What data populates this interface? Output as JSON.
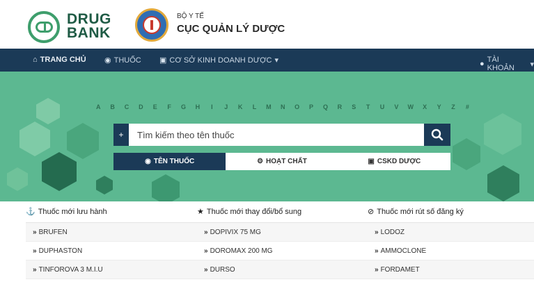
{
  "header": {
    "brand_line1": "DRUG",
    "brand_line2": "BANK",
    "ministry_small": "BỘ Y TẾ",
    "ministry_big": "CỤC QUẢN LÝ DƯỢC"
  },
  "nav": {
    "home": "TRANG CHỦ",
    "drugs": "THUỐC",
    "business": "CƠ SỞ KINH DOANH DƯỢC",
    "account": "TÀI KHOẢN",
    "dropdown_glyph": "▾"
  },
  "alphabet": [
    "A",
    "B",
    "C",
    "D",
    "E",
    "F",
    "G",
    "H",
    "I",
    "J",
    "K",
    "L",
    "M",
    "N",
    "O",
    "P",
    "Q",
    "R",
    "S",
    "T",
    "U",
    "V",
    "W",
    "X",
    "Y",
    "Z",
    "#"
  ],
  "search": {
    "plus": "+",
    "placeholder": "Tìm kiếm theo tên thuốc"
  },
  "tabs": [
    {
      "label": "TÊN THUỐC",
      "icon": "binoculars-icon",
      "active": true
    },
    {
      "label": "HOẠT CHẤT",
      "icon": "gear-icon",
      "active": false
    },
    {
      "label": "CSKD DƯỢC",
      "icon": "briefcase-icon",
      "active": false
    }
  ],
  "lists": {
    "col1_title": "Thuốc mới lưu hành",
    "col2_title": "Thuốc mới thay đổi/bổ sung",
    "col3_title": "Thuốc mới rút số đăng ký",
    "rows": [
      {
        "c1": "BRUFEN",
        "c2": "DOPIVIX 75 MG",
        "c3": "LODOZ"
      },
      {
        "c1": "DUPHASTON",
        "c2": "DOROMAX 200 MG",
        "c3": "AMMOCLONE"
      },
      {
        "c1": "TINFOROVA 3 M.I.U",
        "c2": "DURSO",
        "c3": "FORDAMET"
      }
    ]
  },
  "colors": {
    "nav_bg": "#1b3a57",
    "hero_bg": "#5cb891",
    "brand_green": "#3e9e6c"
  }
}
